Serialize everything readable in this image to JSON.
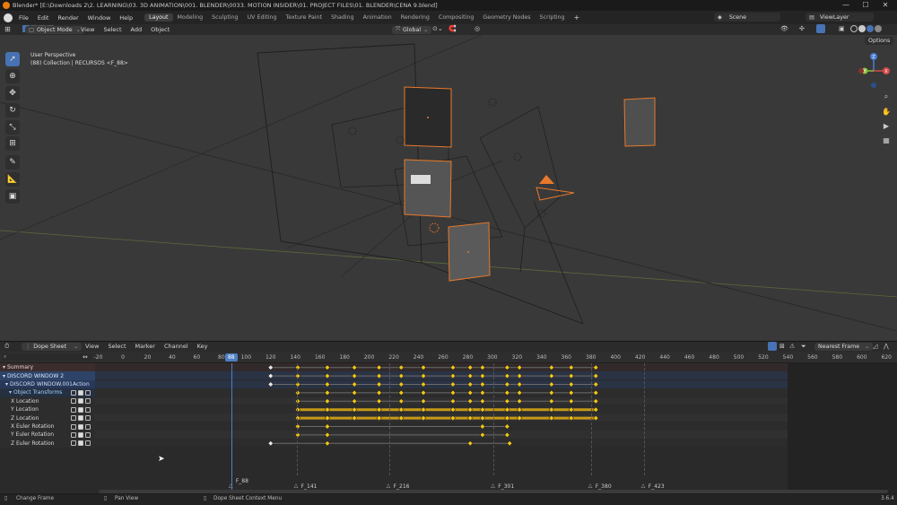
{
  "window": {
    "title": "Blender* [E:\\Downloads 2\\2. LEARNING\\03. 3D ANIMATION\\001. BLENDER\\0033. MOTION INSIDER\\01. PROJECT FILES\\01. BLENDER\\CENA 9.blend]",
    "minimize": "—",
    "maximize": "☐",
    "close": "✕"
  },
  "topbar": {
    "menus": [
      "File",
      "Edit",
      "Render",
      "Window",
      "Help"
    ],
    "workspaces": [
      "Layout",
      "Modeling",
      "Sculpting",
      "UV Editing",
      "Texture Paint",
      "Shading",
      "Animation",
      "Rendering",
      "Compositing",
      "Geometry Nodes",
      "Scripting"
    ],
    "add_tab": "+",
    "scene": "Scene",
    "view_layer": "ViewLayer"
  },
  "viewport_header": {
    "mode": "Object Mode",
    "menus": [
      "View",
      "Select",
      "Add",
      "Object"
    ],
    "orientation": "Global",
    "options": "Options"
  },
  "viewport": {
    "info_line1": "User Perspective",
    "info_line2": "(88) Collection | RECURSOS <F_88>",
    "gizmo": {
      "z": "Z",
      "y": "Y",
      "x": "X"
    }
  },
  "dopesheet_header": {
    "editor": "Dope Sheet",
    "menus": [
      "View",
      "Select",
      "Marker",
      "Channel",
      "Key"
    ],
    "snap": "Nearest Frame"
  },
  "timeline": {
    "current_frame": "88",
    "ticks": [
      "-20",
      "0",
      "20",
      "40",
      "60",
      "80",
      "100",
      "120",
      "140",
      "160",
      "180",
      "200",
      "220",
      "240",
      "260",
      "280",
      "300",
      "320",
      "340",
      "360",
      "380",
      "400",
      "420",
      "440",
      "460",
      "480",
      "500",
      "520",
      "540",
      "560",
      "580",
      "600",
      "620"
    ],
    "markers": [
      {
        "label": "F_88",
        "frame": 88
      },
      {
        "label": "F_141",
        "frame": 141
      },
      {
        "label": "F_216",
        "frame": 216
      },
      {
        "label": "F_301",
        "frame": 301
      },
      {
        "label": "F_380",
        "frame": 380
      },
      {
        "label": "F_423",
        "frame": 423
      }
    ]
  },
  "channels": [
    {
      "label": "Summary",
      "type": "summary",
      "keys": [
        120,
        142,
        166,
        188,
        208,
        226,
        244,
        268,
        282,
        292,
        312,
        322,
        348,
        364,
        384
      ]
    },
    {
      "label": "DISCORD WINDOW 2",
      "type": "object",
      "keys": [
        120,
        142,
        166,
        188,
        208,
        226,
        244,
        268,
        282,
        292,
        312,
        322,
        348,
        364,
        384
      ]
    },
    {
      "label": "DISCORD WINDOW.001Action",
      "type": "action",
      "keys": [
        120,
        142,
        166,
        188,
        208,
        226,
        244,
        268,
        282,
        292,
        312,
        322,
        348,
        364,
        384
      ]
    },
    {
      "label": "Object Transforms",
      "type": "group",
      "keys": [
        142,
        166,
        188,
        208,
        226,
        244,
        268,
        282,
        292,
        312,
        322,
        348,
        364,
        384
      ]
    },
    {
      "label": "X Location",
      "type": "fcurve",
      "keys": [
        142,
        166,
        188,
        208,
        226,
        244,
        268,
        282,
        292,
        312,
        322,
        348,
        364,
        384
      ]
    },
    {
      "label": "Y Location",
      "type": "fcurve",
      "keys": [
        142,
        166,
        188,
        208,
        226,
        244,
        268,
        282,
        292,
        312,
        322,
        348,
        364,
        384
      ]
    },
    {
      "label": "Z Location",
      "type": "fcurve",
      "keys": [
        142,
        166,
        188,
        208,
        226,
        244,
        268,
        282,
        292,
        312,
        322,
        348,
        364,
        384
      ]
    },
    {
      "label": "X Euler Rotation",
      "type": "fcurve",
      "keys": [
        142,
        166,
        292,
        312
      ]
    },
    {
      "label": "Y Euler Rotation",
      "type": "fcurve",
      "keys": [
        142,
        166,
        292,
        312
      ]
    },
    {
      "label": "Z Euler Rotation",
      "type": "fcurve",
      "keys": [
        120,
        166,
        282,
        314
      ]
    }
  ],
  "statusbar": {
    "left": "Change Frame",
    "middle": "Pan View",
    "context": "Dope Sheet Context Menu",
    "version": "3.6.4"
  },
  "colors": {
    "accent": "#4772b3",
    "selected_outline": "#e8792b",
    "keyframe": "#f0c419",
    "playhead": "#4d7fc4"
  }
}
